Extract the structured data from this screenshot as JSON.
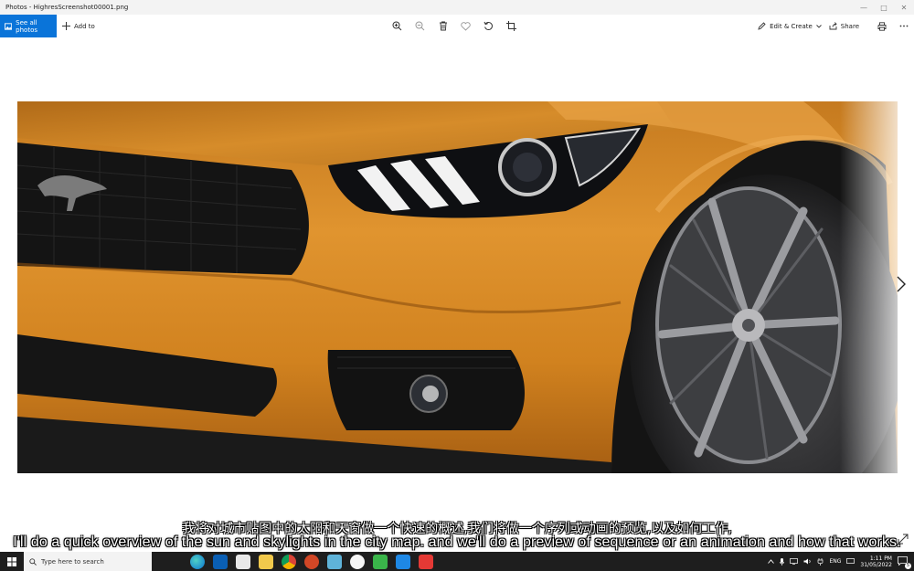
{
  "window": {
    "title": "Photos - HighresScreenshot00001.png"
  },
  "toolbar": {
    "see_all_label": "See all photos",
    "add_to_label": "Add to",
    "edit_create_label": "Edit & Create",
    "share_label": "Share",
    "center_icons": [
      "zoom-in-icon",
      "zoom-out-icon",
      "delete-icon",
      "heart-icon",
      "rotate-icon",
      "crop-icon"
    ]
  },
  "subtitles": {
    "chinese": "我将对城市贴图中的太阳和天窗做一个快速的概述,我们将做一个序列或动画的预览,以及如何工作,",
    "english": "I'll do a quick overview of the sun and skylights in the city map. and we'll do a preview of sequence or an animation and how that works."
  },
  "taskbar": {
    "search_placeholder": "Type here to search",
    "language": "ENG",
    "time": "1:11 PM",
    "date": "31/05/2022",
    "notification_count": "5"
  },
  "colors": {
    "accent": "#0a74d9",
    "car_orange": "#d98a26",
    "taskbar": "#1e1e1e"
  }
}
